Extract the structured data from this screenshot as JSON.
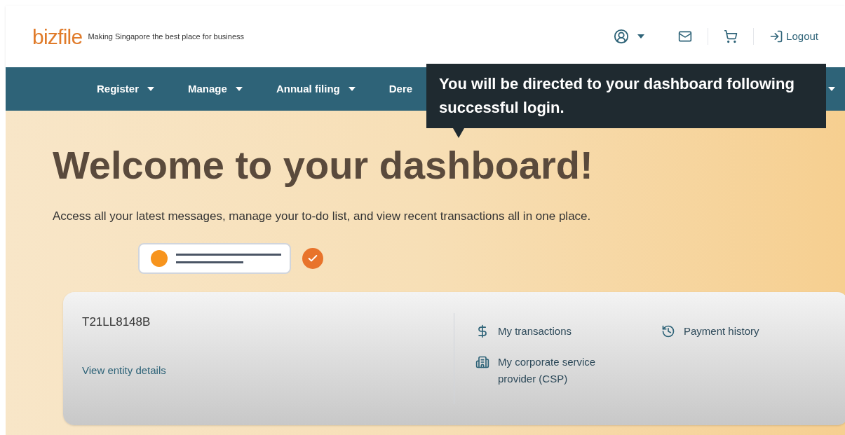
{
  "header": {
    "logo": "bizfile",
    "tagline": "Making Singapore the best place for business",
    "logout": "Logout"
  },
  "nav": {
    "items": [
      {
        "label": "Register"
      },
      {
        "label": "Manage"
      },
      {
        "label": "Annual filing"
      },
      {
        "label": "Dere"
      }
    ]
  },
  "tooltip": {
    "text": "You will be directed to your dashboard following successful login."
  },
  "hero": {
    "title": "Welcome to your dashboard!",
    "subtitle": "Access all your latest messages, manage your to-do list, and view recent transactions all in one place."
  },
  "entity_card": {
    "uen": "T21LL8148B",
    "details_link": "View entity details",
    "links": [
      {
        "kind": "dollar",
        "label": "My transactions"
      },
      {
        "kind": "history",
        "label": "Payment history"
      },
      {
        "kind": "building",
        "label": "My corporate service provider (CSP)"
      }
    ]
  }
}
